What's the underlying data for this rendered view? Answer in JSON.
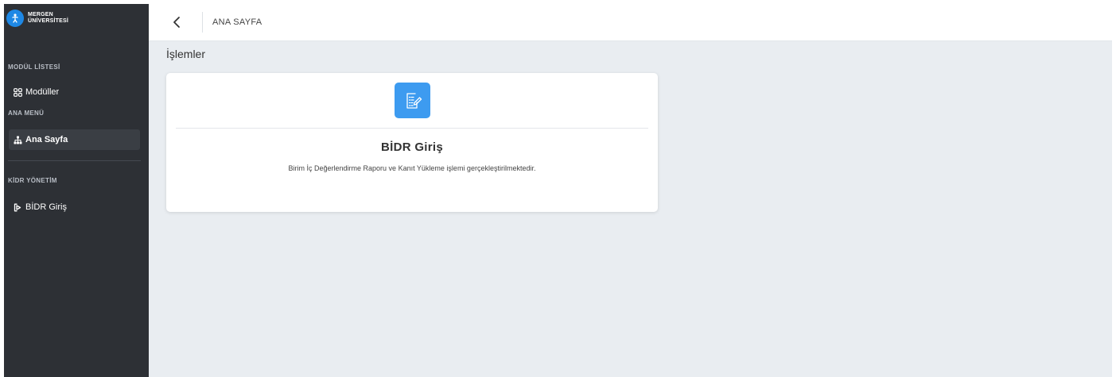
{
  "brand": {
    "line1": "MERGEN",
    "line2": "ÜNİVERSİTESİ"
  },
  "sidebar": {
    "sections": [
      {
        "title": "MODÜL LİSTESİ",
        "items": [
          {
            "label": "Modüller",
            "icon": "grid-icon"
          }
        ]
      },
      {
        "title": "ANA MENÜ",
        "items": [
          {
            "label": "Ana Sayfa",
            "icon": "sitemap-icon",
            "active": true
          }
        ]
      },
      {
        "title": "KİDR YÖNETİM",
        "items": [
          {
            "label": "BİDR Giriş",
            "icon": "login-icon"
          }
        ]
      }
    ]
  },
  "topbar": {
    "breadcrumb": "ANA SAYFA"
  },
  "main": {
    "title": "İşlemler",
    "cards": [
      {
        "title": "BİDR Giriş",
        "description": "Birim İç Değerlendirme Raporu ve Kanıt Yükleme işlemi gerçekleştirilmektedir.",
        "icon": "document-edit-icon"
      }
    ]
  },
  "colors": {
    "sidebar": "#2d3035",
    "accent": "#3d9bf0",
    "background": "#e9edf1"
  }
}
